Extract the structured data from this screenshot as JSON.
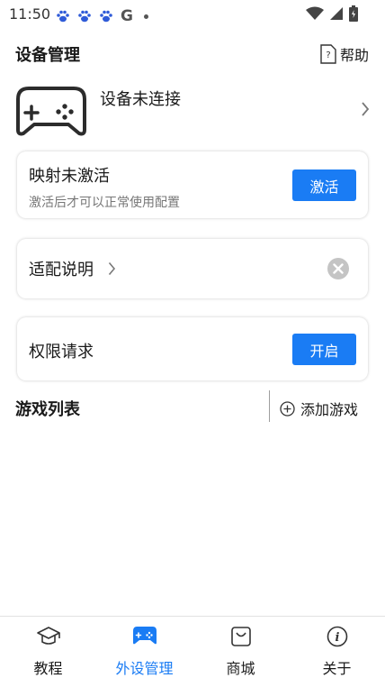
{
  "status_bar": {
    "time": "11:50",
    "carrier_letter": "G"
  },
  "header": {
    "title": "设备管理",
    "help_label": "帮助"
  },
  "device": {
    "status": "设备未连接"
  },
  "mapping_card": {
    "title": "映射未激活",
    "subtitle": "激活后才可以正常使用配置",
    "button_label": "激活"
  },
  "adapt_card": {
    "title": "适配说明"
  },
  "permission_card": {
    "title": "权限请求",
    "button_label": "开启"
  },
  "game_list": {
    "title": "游戏列表",
    "add_label": "添加游戏"
  },
  "bottom_nav": {
    "items": [
      {
        "label": "教程",
        "icon": "graduation-cap-icon"
      },
      {
        "label": "外设管理",
        "icon": "gamepad-icon",
        "active": true
      },
      {
        "label": "商城",
        "icon": "shopping-bag-icon"
      },
      {
        "label": "关于",
        "icon": "info-icon"
      }
    ]
  },
  "colors": {
    "accent": "#1a7cf4",
    "muted_text": "#777777",
    "icon_grey": "#c4c4c4"
  }
}
